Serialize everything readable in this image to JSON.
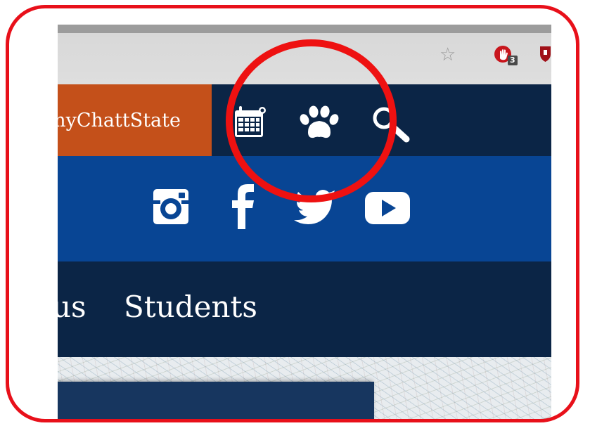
{
  "browser": {
    "bookmark_icon": "star-outline-icon",
    "extension_badge": "3",
    "extension_icon": "hand-stop-icon",
    "shield_icon": "shield-icon"
  },
  "header": {
    "portal_button": "myChattState",
    "utility_icons": [
      "calendar-icon",
      "paw-icon",
      "search-icon"
    ]
  },
  "social": {
    "icons": [
      "instagram-icon",
      "facebook-icon",
      "twitter-icon",
      "youtube-icon"
    ]
  },
  "menu": {
    "items": [
      "us",
      "Students"
    ]
  },
  "colors": {
    "frame_red": "#e8101a",
    "navy": "#0b2546",
    "blue": "#084594",
    "orange": "#c4501a",
    "highlight_red": "#ee1111"
  }
}
